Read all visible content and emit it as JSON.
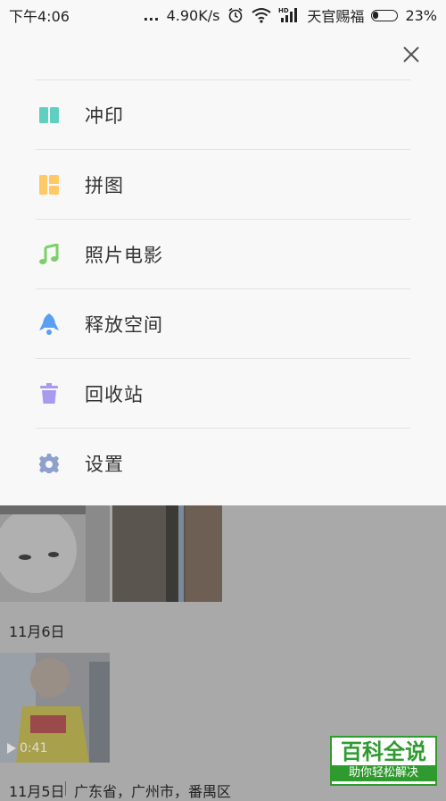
{
  "status_bar": {
    "time": "下午4:06",
    "dots": "...",
    "network_speed": "4.90K/s",
    "carrier": "天官赐福",
    "battery_percent": "23%",
    "battery_level": 0.23,
    "icons": [
      "alarm-icon",
      "wifi-icon",
      "hd-signal-icon",
      "battery-icon"
    ]
  },
  "menu": {
    "close_icon": "close-icon",
    "items": [
      {
        "label": "冲印",
        "icon": "print-icon",
        "color": "#5fd0c0"
      },
      {
        "label": "拼图",
        "icon": "collage-icon",
        "color": "#ffc966"
      },
      {
        "label": "照片电影",
        "icon": "music-note-icon",
        "color": "#7ccf6a"
      },
      {
        "label": "释放空间",
        "icon": "rocket-icon",
        "color": "#5aa0f0"
      },
      {
        "label": "回收站",
        "icon": "trash-icon",
        "color": "#a99af0"
      },
      {
        "label": "设置",
        "icon": "gear-icon",
        "color": "#8fa0cc"
      }
    ]
  },
  "gallery": {
    "groups": [
      {
        "date": "11月6日",
        "location": ""
      },
      {
        "date": "11月5日",
        "location": "广东省，广州市，番禺区"
      }
    ],
    "video_duration": "0:41"
  },
  "watermark": {
    "title": "百科全说",
    "subtitle": "助你轻松解决"
  }
}
